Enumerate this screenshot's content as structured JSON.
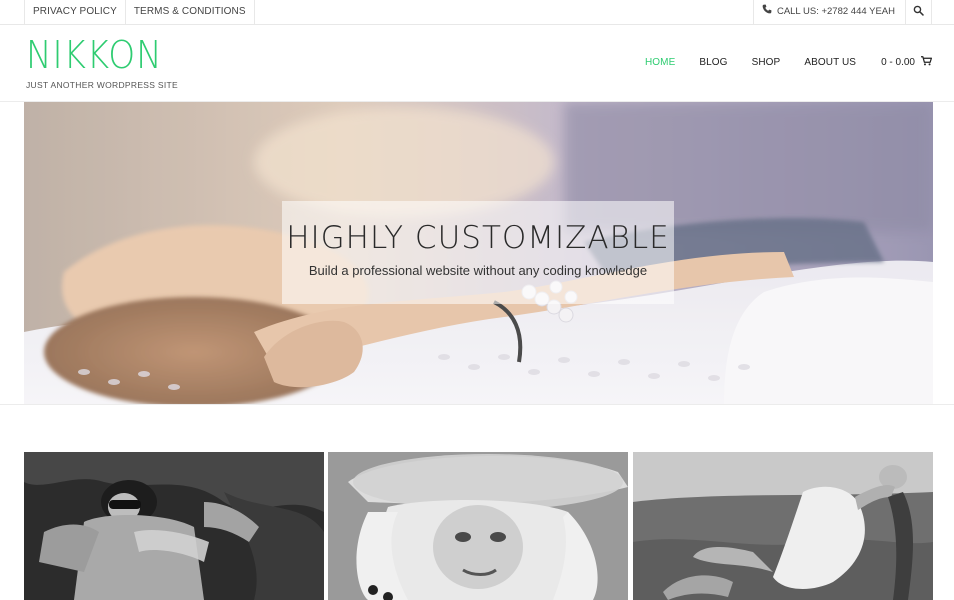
{
  "topbar": {
    "links": [
      "PRIVACY POLICY",
      "TERMS & CONDITIONS"
    ],
    "phone_text": "CALL US: +2782 444 YEAH"
  },
  "header": {
    "logo": "NIKKON",
    "tagline": "JUST ANOTHER WORDPRESS SITE"
  },
  "nav": {
    "items": [
      "HOME",
      "BLOG",
      "SHOP",
      "ABOUT US"
    ],
    "active": "HOME",
    "cart_label": "0 - 0.00"
  },
  "hero": {
    "title": "HIGHLY CUSTOMIZABLE",
    "subtitle": "Build a professional website without any coding knowledge"
  },
  "colors": {
    "accent": "#2ecc71",
    "text": "#222222",
    "border": "#e8e8e8"
  },
  "icons": [
    "phone-icon",
    "search-icon",
    "cart-icon"
  ]
}
